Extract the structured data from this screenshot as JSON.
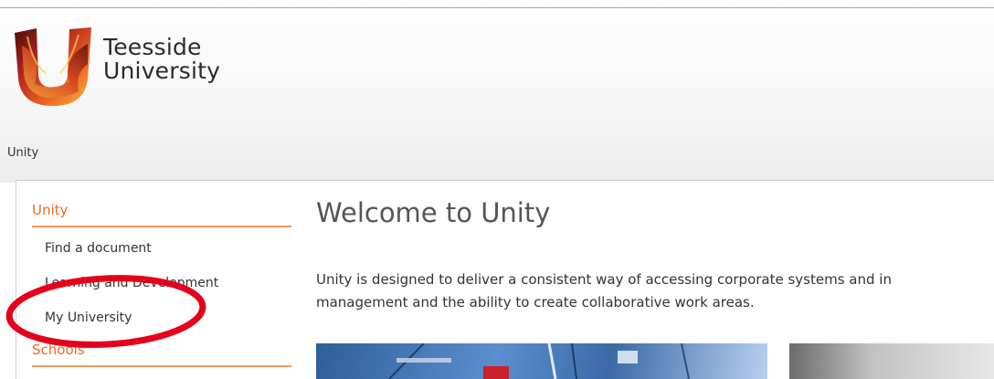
{
  "header": {
    "brand_line1": "Teesside",
    "brand_line2": "University",
    "breadcrumb": "Unity"
  },
  "sidebar": {
    "heading": "Unity",
    "items": [
      {
        "label": "Find a document"
      },
      {
        "label": "Learning and Development"
      },
      {
        "label": "My University"
      }
    ],
    "heading2": "Schools"
  },
  "main": {
    "title": "Welcome to Unity",
    "intro_line1": "Unity is designed to deliver a consistent way of accessing corporate systems and in",
    "intro_line2": "management and the ability to create collaborative work areas."
  },
  "colors": {
    "accent": "#ef6a22",
    "annotation": "#e5001b"
  }
}
